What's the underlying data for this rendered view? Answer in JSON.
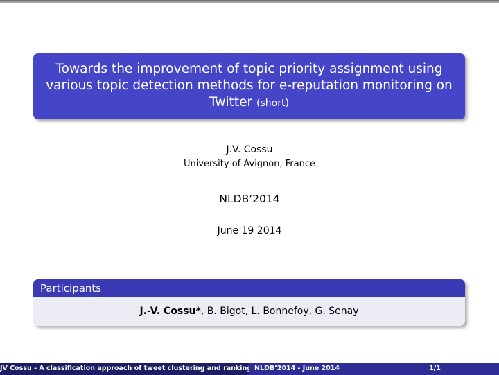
{
  "title": {
    "line1": "Towards the improvement of topic priority assignment using",
    "line2": "various topic detection methods for e-reputation monitoring on",
    "line3": "Twitter",
    "line3_small": "(short)"
  },
  "author": "J.V. Cossu",
  "affiliation": "University of Avignon, France",
  "conference": "NLDB’2014",
  "date": "June 19 2014",
  "participants": {
    "heading": "Participants",
    "lead": "J.-V. Cossu*",
    "others": ", B. Bigot, L. Bonnefoy, G. Senay"
  },
  "footer": {
    "left": "JV Cossu - A classification approach of tweet clustering and ranking",
    "conf_date": "NLDB’2014 - June 2014",
    "page": "1/1"
  },
  "colors": {
    "title_bg": "#4545c8",
    "block_header": "#3a3ab5",
    "footer_left": "#1d1d64",
    "footer_right": "#2d2d95"
  }
}
